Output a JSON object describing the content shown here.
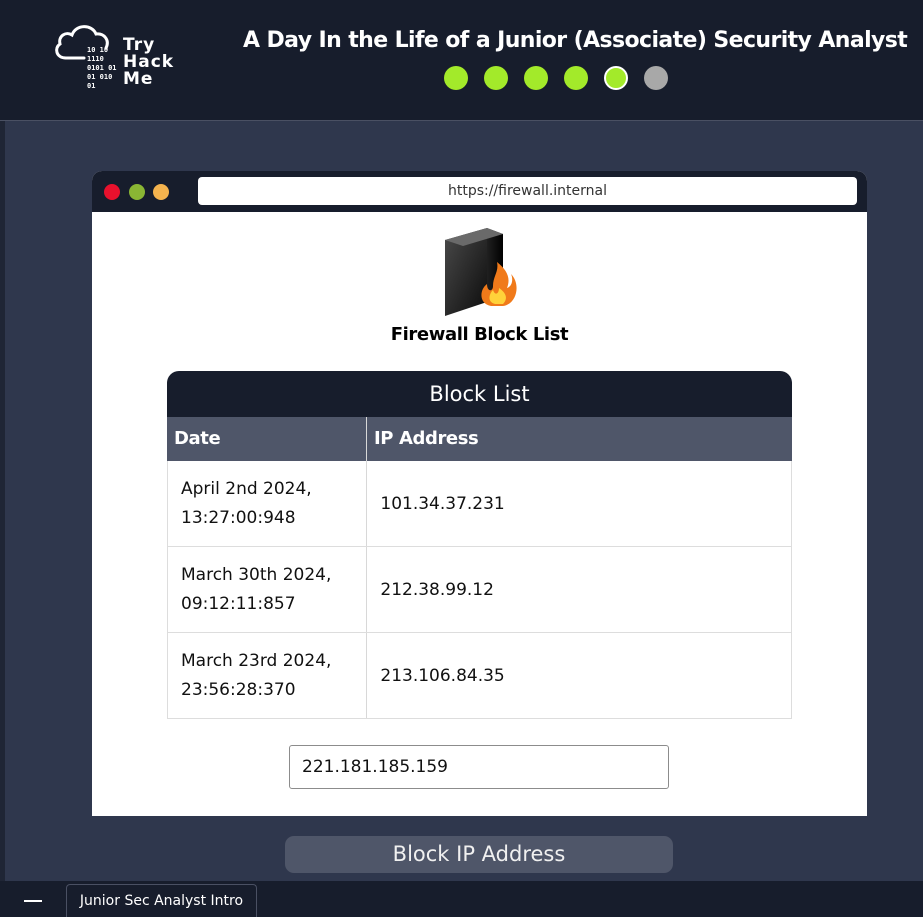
{
  "header": {
    "logo_text": [
      "Try",
      "Hack",
      "Me"
    ],
    "logo_bits": [
      "10  10",
      "1110",
      "0101  01",
      "01  010",
      "  01"
    ],
    "title": "A Day In the Life of a Junior (Associate) Security Analyst",
    "progress": {
      "total": 6,
      "completed": 4,
      "current": 5
    },
    "colors": {
      "done": "#a3ea2a",
      "todo": "#a8a8a8",
      "background": "#171d2c"
    }
  },
  "browser": {
    "url": "https://firewall.internal",
    "traffic_lights": [
      "red",
      "green",
      "yellow"
    ],
    "icon": "firewall-icon",
    "heading": "Firewall Block List"
  },
  "block_list": {
    "caption": "Block List",
    "columns": [
      "Date",
      "IP Address"
    ],
    "rows": [
      {
        "date_line1": "April 2nd 2024,",
        "date_line2": "13:27:00:948",
        "ip": "101.34.37.231"
      },
      {
        "date_line1": "March 30th 2024,",
        "date_line2": "09:12:11:857",
        "ip": "212.38.99.12"
      },
      {
        "date_line1": "March 23rd 2024,",
        "date_line2": "23:56:28:370",
        "ip": "213.106.84.35"
      }
    ]
  },
  "ip_input": {
    "value": "221.181.185.159"
  },
  "block_button": {
    "label": "Block IP Address"
  },
  "taskbar": {
    "tab_label": "Junior Sec Analyst Intro"
  }
}
